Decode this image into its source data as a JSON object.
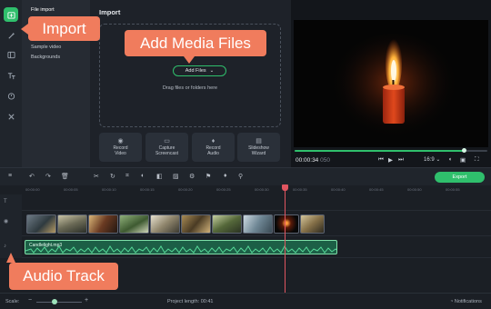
{
  "sidebar": {
    "items": [
      {
        "label": "File import",
        "selected": true
      },
      {
        "label": "Sample video",
        "selected": false
      },
      {
        "label": "Backgrounds",
        "selected": false
      }
    ]
  },
  "rail_icons": [
    "import-icon",
    "magic-icon",
    "layout-icon",
    "text-icon",
    "timer-icon",
    "tools-icon"
  ],
  "import_panel": {
    "title": "Import",
    "add_files_label": "Add Files",
    "drag_hint": "Drag files or folders here",
    "record_buttons": [
      {
        "label": "Record\nVideo",
        "icon": "camera-icon"
      },
      {
        "label": "Capture\nScreencast",
        "icon": "monitor-icon"
      },
      {
        "label": "Record\nAudio",
        "icon": "microphone-icon"
      },
      {
        "label": "Slideshow\nWizard",
        "icon": "slideshow-icon"
      }
    ]
  },
  "preview": {
    "timecode_main": "00:00:34",
    "timecode_sub": "050",
    "aspect_ratio": "16:9",
    "progress": 0.88
  },
  "toolbar": {
    "export_label": "Export"
  },
  "timeline": {
    "ruler_ticks": [
      "00:00:00",
      "00:00:05",
      "00:00:10",
      "00:00:15",
      "00:00:20",
      "00:00:25",
      "00:00:30",
      "00:00:35",
      "00:00:40",
      "00:00:45",
      "00:00:50",
      "00:00:55"
    ],
    "audio_clip_label": "Candlelight.mp3",
    "playhead_time": "00:00:34"
  },
  "status": {
    "scale_label": "Scale:",
    "project_length_label": "Project length:",
    "project_length_value": "00:41",
    "notifications_label": "Notifications"
  },
  "callouts": {
    "import": "Import",
    "add_media_files": "Add Media Files",
    "audio_track": "Audio Track"
  },
  "colors": {
    "accent": "#2fbf6c",
    "callout": "#f07c5d",
    "playhead": "#e05560"
  }
}
